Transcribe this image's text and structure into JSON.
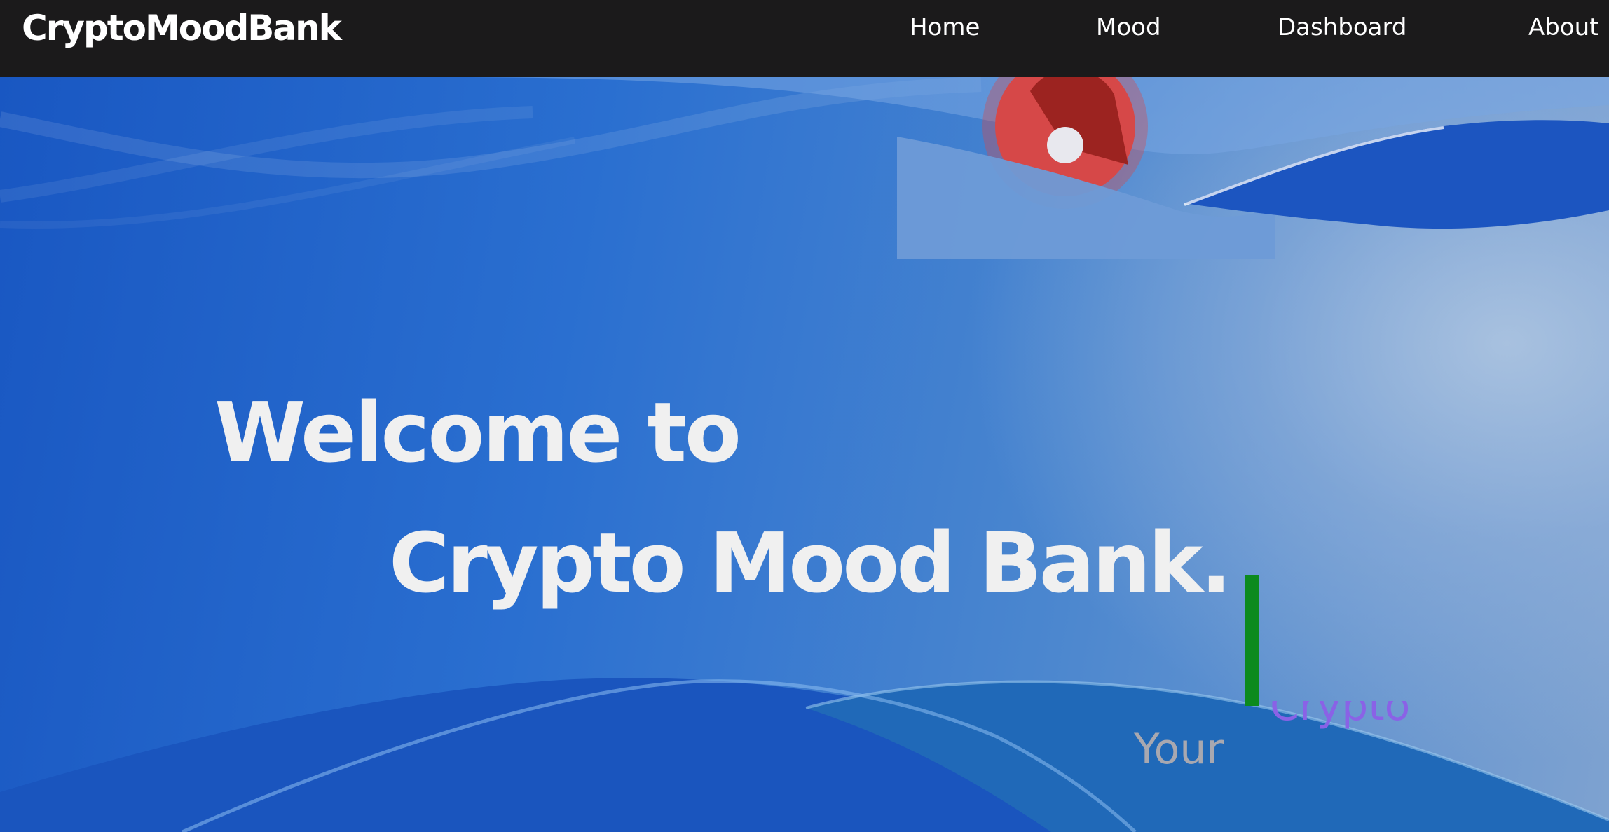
{
  "navbar": {
    "brand": "CryptoMoodBank",
    "links": {
      "home": "Home",
      "mood": "Mood",
      "dashboard": "Dashboard",
      "about": "About"
    }
  },
  "hero": {
    "title_line1": "Welcome to",
    "title_line2": "Crypto Mood Bank.",
    "typing_word_visible": "Your",
    "typing_word_partial": "Crypto"
  },
  "colors": {
    "navbar_bg": "#1b1a1b",
    "hero_blue": "#1e5fc4",
    "cursor_green": "#0c8a1e",
    "typing_purple": "#8a62e6",
    "gauge_red": "#d64848"
  },
  "icons": {
    "gauge": "mood-gauge-icon"
  }
}
